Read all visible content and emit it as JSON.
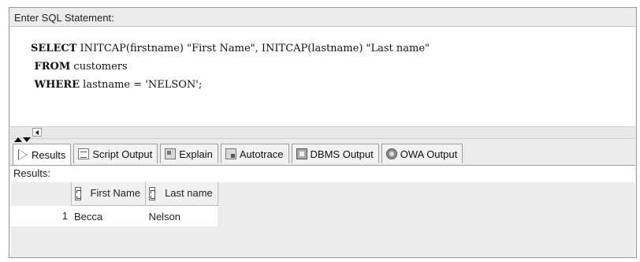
{
  "editor": {
    "label": "Enter SQL Statement:",
    "lines": [
      {
        "kw": "SELECT",
        "rest": " INITCAP(firstname) \"First Name\", INITCAP(lastname) \"Last name\""
      },
      {
        "kw": " FROM",
        "rest": " customers"
      },
      {
        "kw": " WHERE",
        "rest": " lastname = 'NELSON';"
      }
    ]
  },
  "tabs": [
    {
      "label": "Results",
      "icon": "play-icon"
    },
    {
      "label": "Script Output",
      "icon": "script-icon"
    },
    {
      "label": "Explain",
      "icon": "explain-icon"
    },
    {
      "label": "Autotrace",
      "icon": "autotrace-icon"
    },
    {
      "label": "DBMS Output",
      "icon": "dbms-icon"
    },
    {
      "label": "OWA Output",
      "icon": "owa-icon"
    }
  ],
  "results": {
    "label": "Results:",
    "columns": [
      "First Name",
      "Last name"
    ],
    "rows": [
      {
        "num": "1",
        "cells": [
          "Becca",
          "Nelson"
        ]
      }
    ]
  }
}
